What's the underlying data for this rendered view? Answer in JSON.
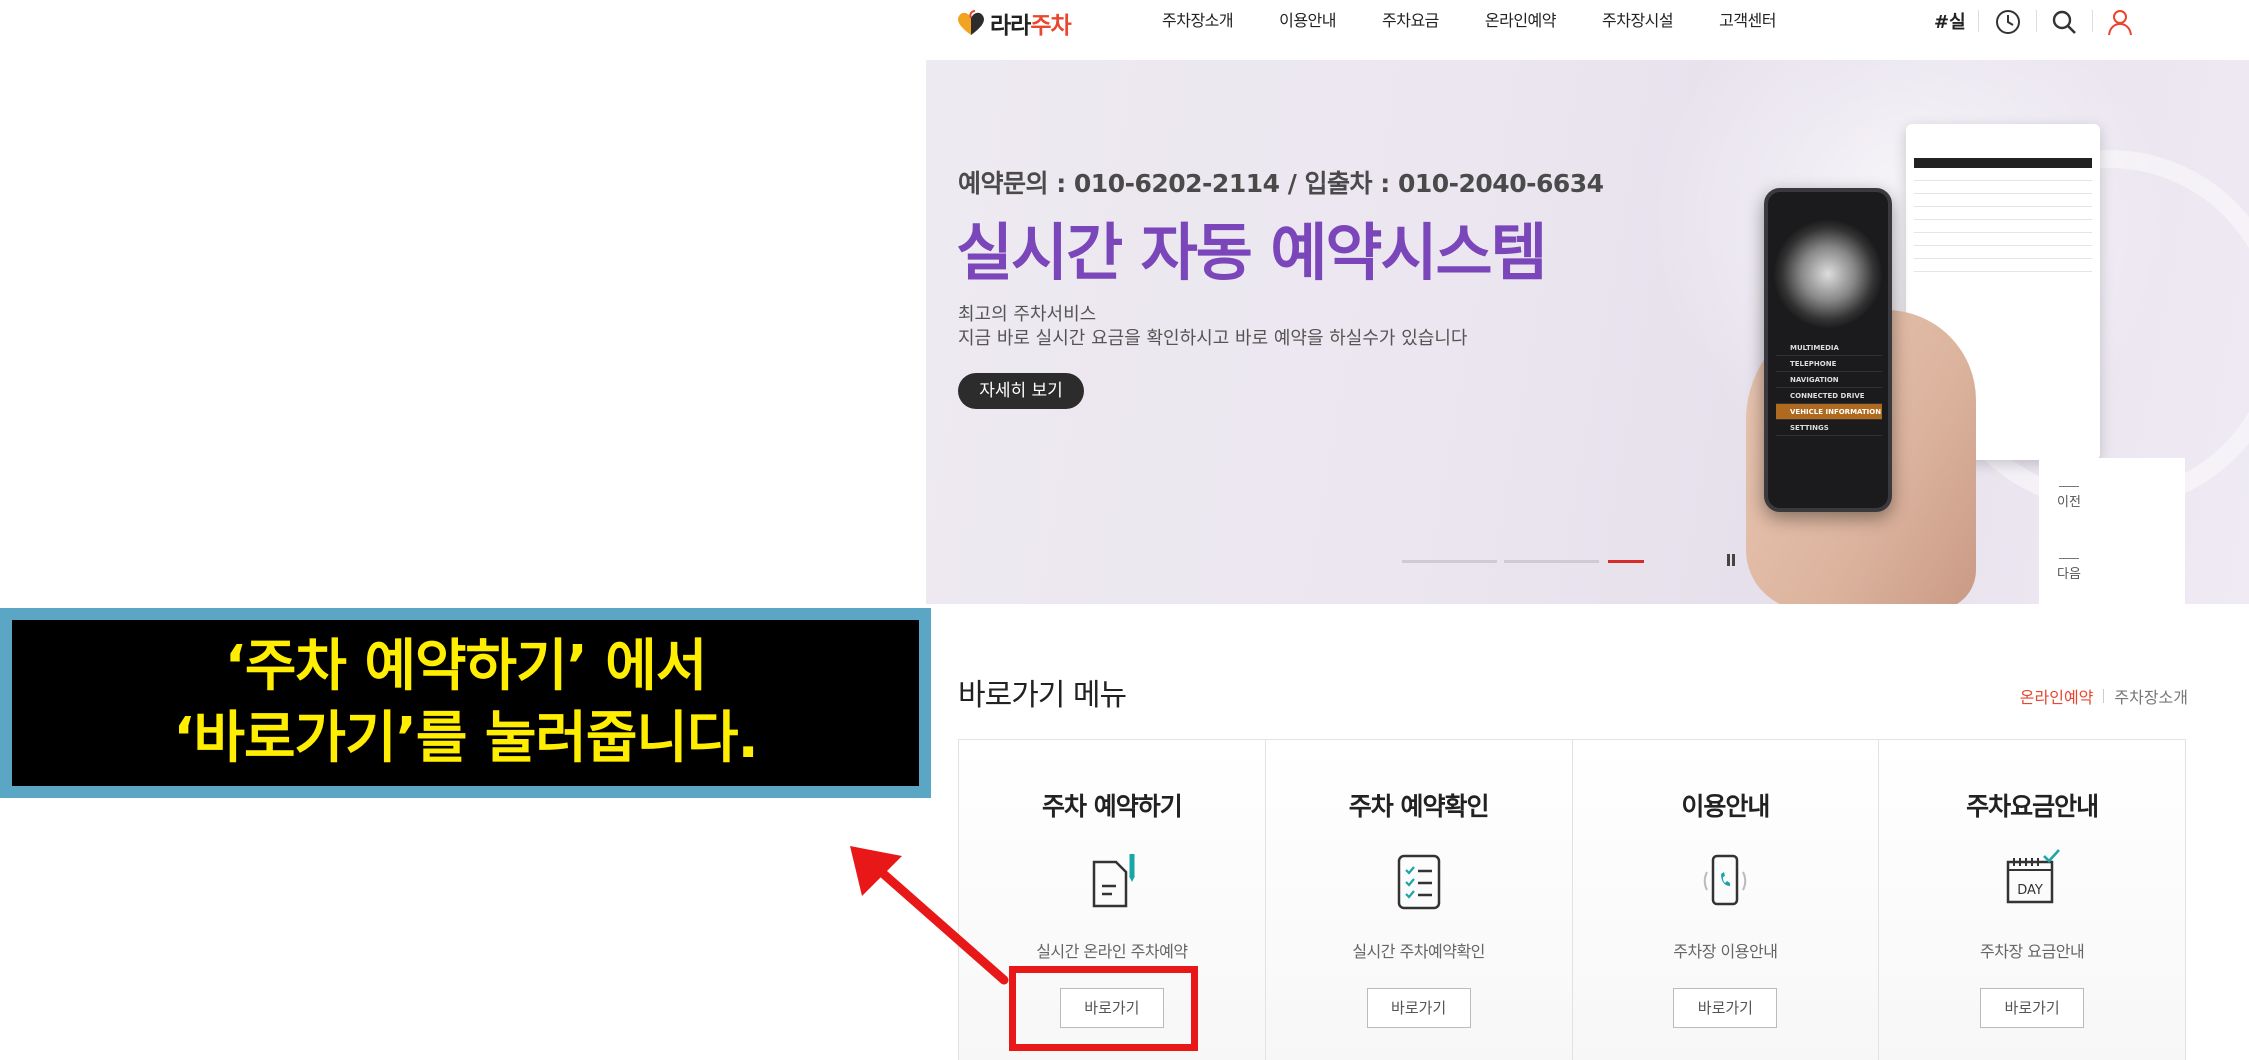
{
  "header": {
    "logo": {
      "text_main": "라라",
      "text_accent": "주차"
    },
    "nav": [
      "주차장소개",
      "이용안내",
      "주차요금",
      "온라인예약",
      "주차장시설",
      "고객센터"
    ],
    "hashtag": "#실",
    "icons": [
      "clock-icon",
      "search-icon",
      "user-icon"
    ]
  },
  "hero": {
    "contact": "예약문의 : 010-6202-2114 / 입출차 : 010-2040-6634",
    "title": "실시간 자동 예약시스템",
    "desc_line1": "최고의 주차서비스",
    "desc_line2": "지금 바로 실시간 요금을 확인하시고 바로 예약을 하실수가 있습니다",
    "button": "자세히 보기",
    "slide_count": 3,
    "active_slide": 3,
    "prev_label": "이전",
    "next_label": "다음",
    "phone_menu": [
      "MULTIMEDIA",
      "TELEPHONE",
      "NAVIGATION",
      "CONNECTED DRIVE",
      "VEHICLE INFORMATION",
      "SETTINGS"
    ]
  },
  "quick_menu": {
    "title": "바로가기 메뉴",
    "link_active": "온라인예약",
    "link_other": "주차장소개",
    "cards": [
      {
        "title": "주차 예약하기",
        "icon": "pen-document-icon",
        "desc": "실시간 온라인 주차예약",
        "button": "바로가기"
      },
      {
        "title": "주차 예약확인",
        "icon": "checklist-icon",
        "desc": "실시간 주차예약확인",
        "button": "바로가기"
      },
      {
        "title": "이용안내",
        "icon": "phone-call-icon",
        "desc": "주차장 이용안내",
        "button": "바로가기"
      },
      {
        "title": "주차요금안내",
        "icon": "calendar-day-icon",
        "desc": "주차장 요금안내",
        "button": "바로가기"
      }
    ]
  },
  "annotation": {
    "line1": "‘주차 예약하기’ 에서",
    "line2": "‘바로가기’를 눌러줍니다.",
    "colors": {
      "text": "#ffee00",
      "frame": "#5aa6c4",
      "highlight": "#e81818"
    }
  },
  "colors": {
    "brand_purple": "#7a46b9",
    "accent_red": "#e8472f"
  }
}
